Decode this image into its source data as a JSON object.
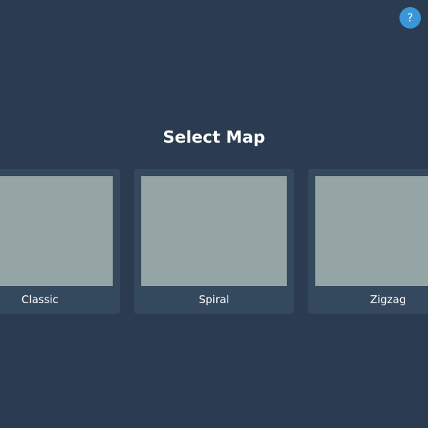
{
  "help": {
    "label": "?"
  },
  "title": "Select Map",
  "colors": {
    "background": "#2c3c50",
    "card": "#34495e",
    "preview": "#95a5a6",
    "accent": "#3a96d9",
    "text": "#ffffff"
  },
  "maps": [
    {
      "label": "Classic"
    },
    {
      "label": "Spiral"
    },
    {
      "label": "Zigzag"
    }
  ]
}
